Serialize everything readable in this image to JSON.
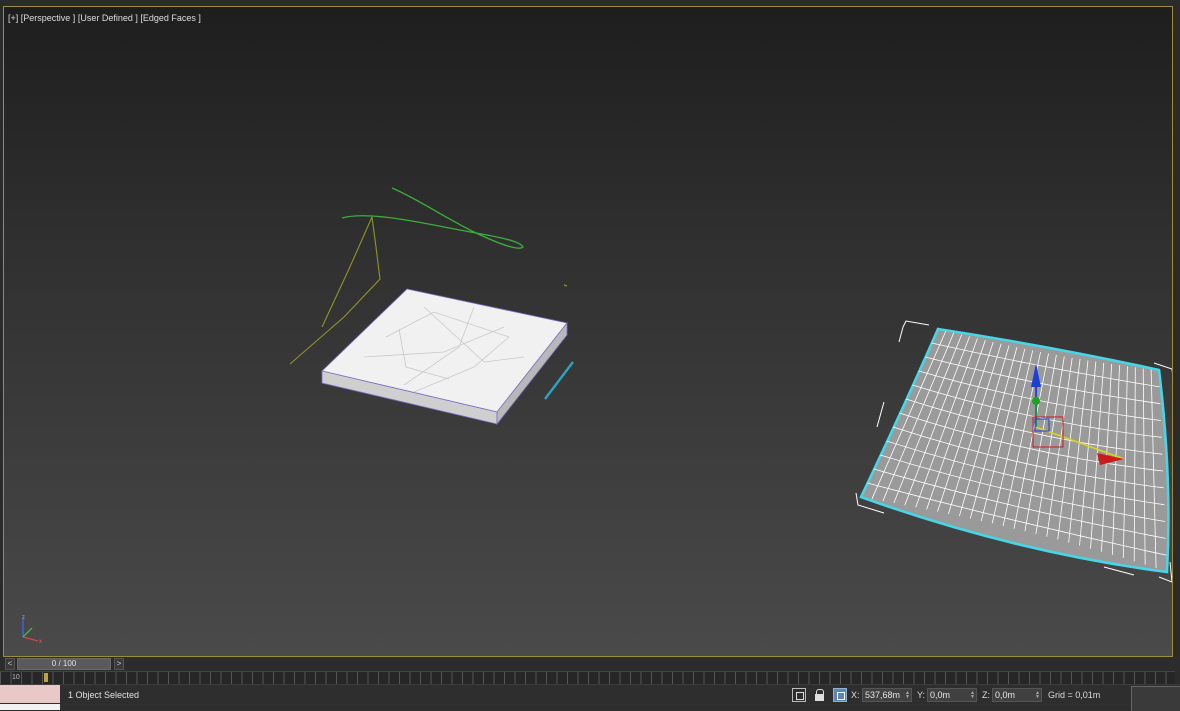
{
  "viewport": {
    "label_plus": "[+]",
    "label_view": "[Perspective ]",
    "label_mode": "[User Defined ]",
    "label_shading": "[Edged Faces ]",
    "border_color": "#a08c3c"
  },
  "timeline": {
    "prev_label": "<",
    "next_label": ">",
    "slider_text": "0 / 100",
    "ruler_start": "10"
  },
  "status_bar": {
    "selection_text": "1 Object Selected",
    "x_label": "X:",
    "x_value": "537,68m",
    "y_label": "Y:",
    "y_value": "0,0m",
    "z_label": "Z:",
    "z_value": "0,0m",
    "grid_text": "Grid = 0,01m",
    "icons": [
      "isolate-selection-icon",
      "lock-icon",
      "absolute-relative-toggle-icon"
    ]
  },
  "colors": {
    "accent_selection": "#46d6e6",
    "spline_green": "#3cae3c",
    "spline_olive": "#8e9626",
    "gizmo_x": "#cc1b1b",
    "gizmo_y": "#1fa11f",
    "gizmo_z": "#1b3fd8"
  }
}
